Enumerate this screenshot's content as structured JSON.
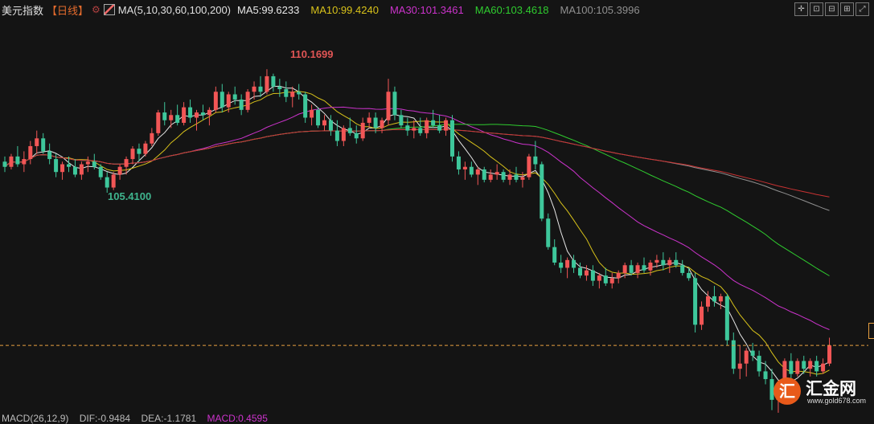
{
  "header": {
    "title": "美元指数",
    "period": "【日线】",
    "gear_symbol": "⚙",
    "ma_params": "MA(5,10,30,60,100,200)",
    "ma_items": [
      {
        "label": "MA5:99.6233",
        "color": "#e8e8e8"
      },
      {
        "label": "MA10:99.4240",
        "color": "#d8c21a"
      },
      {
        "label": "MA30:101.3461",
        "color": "#cc33cc"
      },
      {
        "label": "MA60:103.4618",
        "color": "#2fcc2f"
      },
      {
        "label": "MA100:105.3996",
        "color": "#909090"
      }
    ],
    "toolbar_icons": [
      "crosshair-icon",
      "fit-icon",
      "zoom-out-icon",
      "zoom-in-icon",
      "expand-icon"
    ]
  },
  "chart_data": {
    "type": "candlestick",
    "high_label": "110.1699",
    "low_label": "105.4100",
    "last_price_line": 99.5,
    "ylim": [
      96.9,
      112.1
    ],
    "candle_up_color": "#f25656",
    "candle_down_color": "#3ec79b",
    "candles": [
      [
        106.6,
        106.8,
        106.2,
        106.4
      ],
      [
        106.4,
        106.9,
        106.3,
        106.8
      ],
      [
        106.8,
        107.2,
        106.4,
        106.5
      ],
      [
        106.5,
        107.0,
        106.2,
        106.7
      ],
      [
        106.7,
        107.4,
        106.5,
        107.2
      ],
      [
        107.2,
        107.8,
        106.9,
        107.5
      ],
      [
        107.5,
        107.7,
        106.9,
        107.0
      ],
      [
        107.0,
        107.3,
        106.5,
        106.7
      ],
      [
        106.7,
        106.9,
        106.0,
        106.2
      ],
      [
        106.2,
        106.6,
        105.9,
        106.5
      ],
      [
        106.5,
        106.8,
        106.2,
        106.4
      ],
      [
        106.4,
        106.7,
        106.0,
        106.1
      ],
      [
        106.1,
        106.6,
        105.9,
        106.5
      ],
      [
        106.5,
        106.8,
        106.2,
        106.6
      ],
      [
        106.6,
        106.9,
        106.3,
        106.4
      ],
      [
        106.4,
        106.5,
        105.9,
        106.0
      ],
      [
        106.0,
        106.2,
        105.4,
        105.6
      ],
      [
        105.6,
        106.2,
        105.5,
        106.1
      ],
      [
        106.1,
        106.5,
        105.9,
        106.4
      ],
      [
        106.4,
        106.8,
        106.1,
        106.7
      ],
      [
        106.7,
        107.2,
        106.5,
        107.1
      ],
      [
        107.1,
        107.3,
        106.6,
        106.9
      ],
      [
        106.9,
        107.4,
        106.8,
        107.3
      ],
      [
        107.3,
        107.9,
        107.2,
        107.7
      ],
      [
        107.7,
        108.6,
        107.6,
        108.5
      ],
      [
        108.5,
        108.9,
        108.0,
        108.2
      ],
      [
        108.2,
        108.6,
        107.9,
        108.4
      ],
      [
        108.4,
        108.8,
        108.0,
        108.1
      ],
      [
        108.1,
        108.9,
        108.0,
        108.7
      ],
      [
        108.7,
        109.0,
        108.1,
        108.3
      ],
      [
        108.3,
        108.6,
        107.8,
        108.5
      ],
      [
        108.5,
        108.8,
        108.2,
        108.4
      ],
      [
        108.4,
        108.7,
        108.0,
        108.6
      ],
      [
        108.6,
        109.5,
        108.5,
        109.3
      ],
      [
        109.3,
        109.6,
        108.5,
        108.7
      ],
      [
        108.7,
        109.3,
        108.5,
        109.2
      ],
      [
        109.2,
        109.5,
        108.8,
        109.0
      ],
      [
        109.0,
        109.2,
        108.4,
        108.6
      ],
      [
        108.6,
        109.4,
        108.5,
        109.3
      ],
      [
        109.3,
        109.7,
        109.0,
        109.5
      ],
      [
        109.5,
        109.9,
        109.1,
        109.3
      ],
      [
        109.3,
        110.17,
        109.2,
        109.9
      ],
      [
        109.9,
        110.0,
        109.3,
        109.5
      ],
      [
        109.5,
        109.8,
        109.1,
        109.4
      ],
      [
        109.4,
        109.7,
        108.9,
        109.1
      ],
      [
        109.1,
        109.5,
        108.7,
        109.3
      ],
      [
        109.3,
        109.6,
        109.0,
        109.2
      ],
      [
        109.2,
        109.3,
        108.1,
        108.3
      ],
      [
        108.3,
        108.8,
        108.0,
        108.6
      ],
      [
        108.6,
        108.7,
        107.9,
        108.0
      ],
      [
        108.0,
        108.4,
        107.8,
        108.2
      ],
      [
        108.2,
        108.4,
        107.6,
        107.8
      ],
      [
        107.8,
        108.2,
        107.2,
        107.4
      ],
      [
        107.4,
        108.0,
        107.2,
        107.9
      ],
      [
        107.9,
        108.3,
        107.6,
        107.7
      ],
      [
        107.7,
        108.0,
        107.3,
        107.5
      ],
      [
        107.5,
        108.3,
        107.4,
        108.1
      ],
      [
        108.1,
        108.5,
        107.9,
        108.3
      ],
      [
        108.3,
        108.5,
        107.7,
        107.9
      ],
      [
        107.9,
        108.3,
        107.7,
        108.2
      ],
      [
        108.2,
        109.8,
        108.0,
        109.3
      ],
      [
        109.3,
        109.5,
        108.2,
        108.4
      ],
      [
        108.4,
        108.6,
        107.9,
        108.0
      ],
      [
        108.0,
        108.3,
        107.6,
        107.8
      ],
      [
        107.8,
        108.2,
        107.5,
        107.9
      ],
      [
        107.9,
        108.3,
        107.6,
        107.7
      ],
      [
        107.7,
        108.3,
        107.5,
        108.2
      ],
      [
        108.2,
        108.6,
        107.9,
        108.0
      ],
      [
        108.0,
        108.4,
        107.7,
        107.8
      ],
      [
        107.8,
        108.3,
        107.6,
        108.2
      ],
      [
        108.2,
        108.4,
        106.6,
        106.8
      ],
      [
        106.8,
        107.0,
        106.1,
        106.3
      ],
      [
        106.3,
        106.6,
        105.9,
        106.4
      ],
      [
        106.4,
        106.6,
        106.0,
        106.1
      ],
      [
        106.1,
        106.4,
        105.7,
        106.3
      ],
      [
        106.3,
        106.4,
        105.8,
        105.9
      ],
      [
        105.9,
        106.3,
        105.8,
        106.1
      ],
      [
        106.1,
        106.5,
        105.9,
        106.2
      ],
      [
        106.2,
        106.3,
        105.8,
        105.9
      ],
      [
        105.9,
        106.3,
        105.7,
        106.1
      ],
      [
        106.1,
        106.4,
        105.8,
        105.9
      ],
      [
        105.9,
        106.2,
        105.6,
        106.0
      ],
      [
        106.0,
        106.9,
        105.9,
        106.8
      ],
      [
        106.8,
        107.4,
        106.3,
        106.5
      ],
      [
        106.5,
        106.6,
        104.3,
        104.4
      ],
      [
        104.4,
        104.6,
        103.2,
        103.3
      ],
      [
        103.3,
        103.6,
        102.6,
        102.7
      ],
      [
        102.7,
        103.0,
        102.3,
        102.5
      ],
      [
        102.5,
        102.9,
        102.1,
        102.8
      ],
      [
        102.8,
        103.0,
        102.3,
        102.5
      ],
      [
        102.5,
        102.7,
        102.1,
        102.2
      ],
      [
        102.2,
        102.6,
        102.0,
        102.4
      ],
      [
        102.4,
        102.6,
        101.8,
        102.0
      ],
      [
        102.0,
        102.3,
        101.7,
        102.2
      ],
      [
        102.2,
        102.5,
        101.8,
        101.9
      ],
      [
        101.9,
        102.3,
        101.7,
        102.1
      ],
      [
        102.1,
        102.4,
        101.9,
        102.3
      ],
      [
        102.3,
        102.7,
        102.1,
        102.6
      ],
      [
        102.6,
        102.8,
        102.2,
        102.3
      ],
      [
        102.3,
        102.7,
        102.1,
        102.6
      ],
      [
        102.6,
        102.9,
        102.3,
        102.4
      ],
      [
        102.4,
        102.8,
        102.2,
        102.7
      ],
      [
        102.7,
        103.0,
        102.5,
        102.8
      ],
      [
        102.8,
        103.1,
        102.4,
        102.6
      ],
      [
        102.6,
        102.9,
        102.3,
        102.8
      ],
      [
        102.8,
        103.1,
        102.5,
        102.6
      ],
      [
        102.6,
        102.8,
        102.2,
        102.3
      ],
      [
        102.3,
        102.5,
        102.0,
        102.1
      ],
      [
        102.1,
        102.3,
        100.0,
        100.3
      ],
      [
        100.3,
        101.2,
        100.1,
        101.0
      ],
      [
        101.0,
        101.6,
        100.8,
        101.4
      ],
      [
        101.4,
        101.8,
        101.0,
        101.2
      ],
      [
        101.2,
        101.5,
        100.9,
        101.4
      ],
      [
        101.4,
        101.5,
        99.5,
        99.7
      ],
      [
        99.7,
        100.0,
        98.4,
        98.6
      ],
      [
        98.6,
        99.5,
        98.2,
        98.8
      ],
      [
        98.8,
        99.4,
        98.3,
        99.3
      ],
      [
        99.3,
        99.6,
        98.9,
        99.1
      ],
      [
        99.1,
        99.3,
        98.3,
        98.5
      ],
      [
        98.5,
        98.9,
        98.0,
        98.2
      ],
      [
        98.2,
        98.6,
        97.0,
        97.4
      ],
      [
        97.4,
        97.8,
        96.9,
        97.6
      ],
      [
        97.6,
        99.0,
        97.4,
        98.9
      ],
      [
        98.9,
        99.2,
        98.2,
        98.4
      ],
      [
        98.4,
        99.0,
        98.3,
        98.9
      ],
      [
        98.9,
        99.1,
        98.4,
        98.6
      ],
      [
        98.6,
        99.0,
        98.3,
        98.9
      ],
      [
        98.9,
        99.1,
        98.3,
        98.5
      ],
      [
        98.5,
        99.0,
        98.4,
        98.8
      ],
      [
        98.8,
        99.8,
        98.7,
        99.5
      ]
    ]
  },
  "macd": {
    "params": "MACD(26,12,9)",
    "dif": "DIF:-0.9484",
    "dea": "DEA:-1.1781",
    "macd": "MACD:0.4595"
  },
  "logo": {
    "badge": "汇",
    "name": "汇金网",
    "url": "www.gold678.com"
  }
}
